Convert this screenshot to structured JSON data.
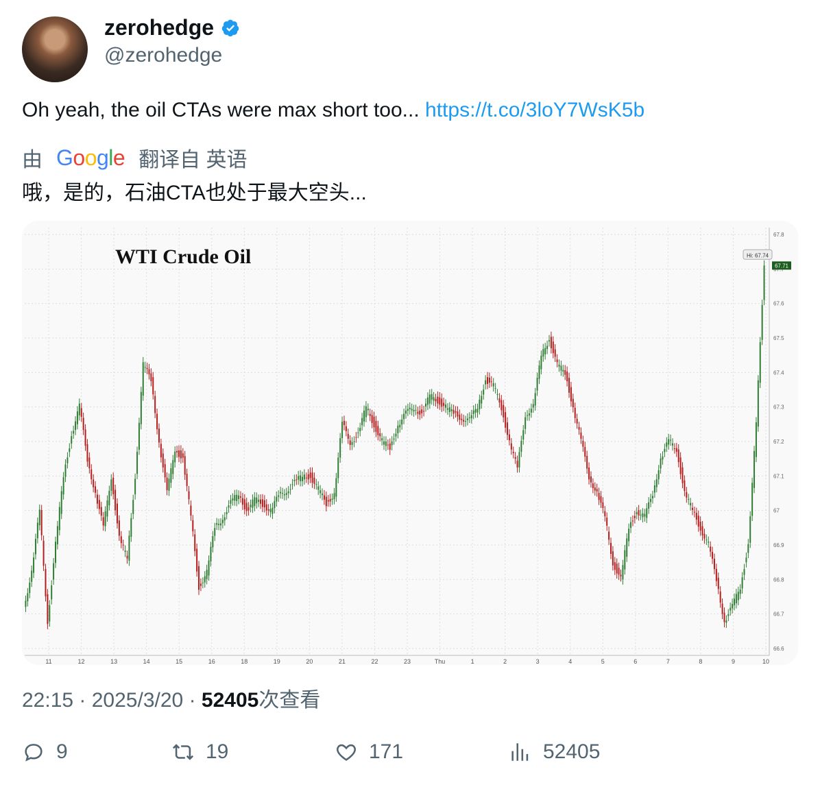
{
  "user": {
    "display_name": "zerohedge",
    "handle": "@zerohedge",
    "verified": true,
    "accent_color": "#1d9bf0"
  },
  "tweet": {
    "text": "Oh yeah, the oil CTAs were max short too...",
    "link": "https://t.co/3loY7WsK5b",
    "translation_prefix": "由",
    "translation_provider": "Google",
    "translation_suffix": "翻译自 英语",
    "translated_text": "哦，是的，石油CTA也处于最大空头...",
    "time": "22:15",
    "date": "2025/3/20",
    "views": "52405",
    "views_suffix": "次查看"
  },
  "actions": {
    "replies": "9",
    "retweets": "19",
    "likes": "171",
    "views": "52405"
  },
  "chart_data": {
    "type": "line",
    "title": "WTI Crude Oil",
    "x_ticks": [
      "11",
      "12",
      "13",
      "14",
      "15",
      "16",
      "18",
      "19",
      "20",
      "21",
      "22",
      "23",
      "Thu",
      "1",
      "2",
      "3",
      "4",
      "5",
      "6",
      "7",
      "8",
      "9",
      "10"
    ],
    "y_ticks": [
      66.6,
      66.7,
      66.8,
      66.9,
      67,
      67.1,
      67.2,
      67.3,
      67.4,
      67.5,
      67.6,
      67.7,
      67.8
    ],
    "y_tick_labels": [
      "66.6",
      "66.7",
      "66.8",
      "66.9",
      "67",
      "67.1",
      "67.2",
      "67.3",
      "67.4",
      "67.5",
      "67.6",
      "67.7",
      "67.8"
    ],
    "ylim": [
      66.58,
      67.82
    ],
    "hi_label": "Hi: 67.74",
    "last_label": "67.71",
    "series": [
      {
        "values": [
          66.72,
          66.82,
          67.0,
          66.68,
          66.9,
          67.1,
          67.22,
          67.3,
          67.15,
          67.05,
          66.95,
          67.1,
          66.92,
          66.86,
          67.1,
          67.42,
          67.38,
          67.2,
          67.05,
          67.18,
          67.15,
          66.98,
          66.78,
          66.82,
          66.95,
          66.98,
          67.02,
          67.05,
          67.0,
          67.03,
          67.02,
          67.0,
          67.04,
          67.06,
          67.08,
          67.1,
          67.1,
          67.06,
          67.02,
          67.05,
          67.25,
          67.2,
          67.22,
          67.3,
          67.25,
          67.2,
          67.18,
          67.25,
          67.28,
          67.3,
          67.28,
          67.33,
          67.32,
          67.3,
          67.28,
          67.27,
          67.26,
          67.3,
          67.38,
          67.36,
          67.3,
          67.2,
          67.12,
          67.28,
          67.3,
          67.45,
          67.5,
          67.42,
          67.4,
          67.3,
          67.2,
          67.1,
          67.05,
          66.98,
          66.85,
          66.8,
          66.95,
          67.0,
          66.98,
          67.05,
          67.15,
          67.2,
          67.18,
          67.05,
          67.0,
          66.95,
          66.9,
          66.8,
          66.68,
          66.72,
          66.78,
          66.9,
          67.25,
          67.72
        ]
      }
    ],
    "colors": {
      "up": "#2e7d32",
      "down": "#b71c1c",
      "grid": "#dddddd",
      "last_badge": "#1b5e20"
    },
    "grid": true
  }
}
